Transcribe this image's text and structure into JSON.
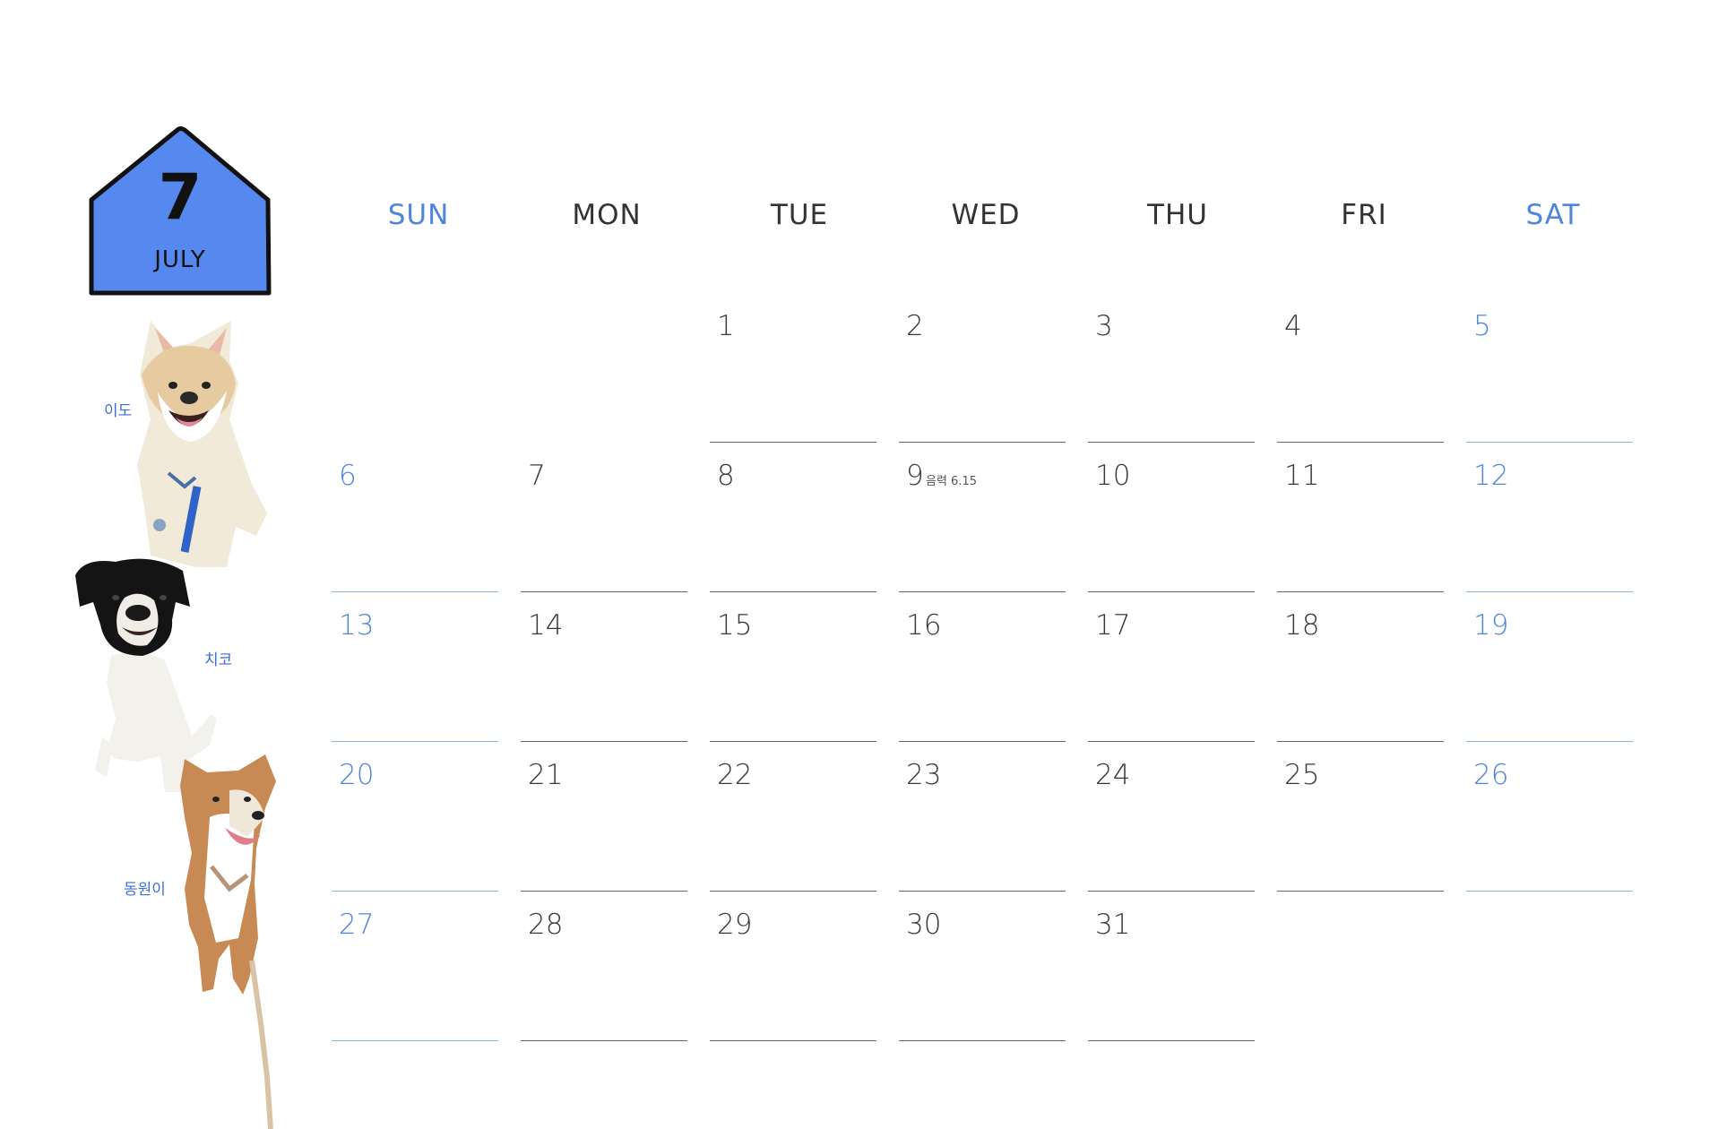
{
  "month": {
    "number": "7",
    "name": "JULY",
    "color": "#5589f0"
  },
  "dogs": [
    {
      "name": "이도",
      "icon": "cream-dog-photo"
    },
    {
      "name": "치코",
      "icon": "black-white-dog-photo"
    },
    {
      "name": "동원이",
      "icon": "brown-white-dog-photo"
    }
  ],
  "weekdays": [
    "SUN",
    "MON",
    "TUE",
    "WED",
    "THU",
    "FRI",
    "SAT"
  ],
  "weeks": [
    [
      "",
      "",
      "1",
      "2",
      "3",
      "4",
      "5"
    ],
    [
      "6",
      "7",
      "8",
      "9",
      "10",
      "11",
      "12"
    ],
    [
      "13",
      "14",
      "15",
      "16",
      "17",
      "18",
      "19"
    ],
    [
      "20",
      "21",
      "22",
      "23",
      "24",
      "25",
      "26"
    ],
    [
      "27",
      "28",
      "29",
      "30",
      "31",
      "",
      ""
    ]
  ],
  "notes": {
    "lunar_9": "음력 6.15"
  },
  "colors": {
    "weekend": "#4f86dc",
    "text": "#3a3a3a"
  }
}
